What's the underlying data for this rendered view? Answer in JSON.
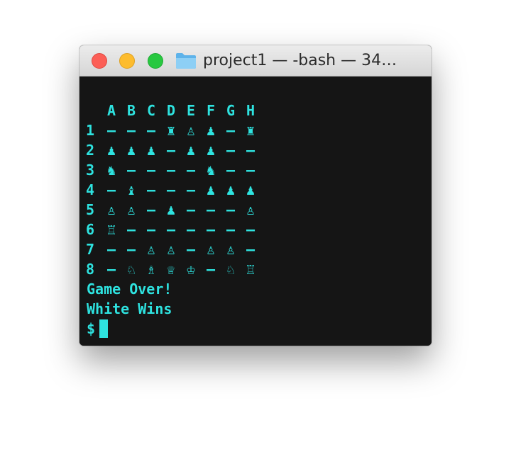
{
  "window": {
    "title": "project1 — -bash — 34…",
    "folder_icon": "folder-icon"
  },
  "board": {
    "columns": [
      "A",
      "B",
      "C",
      "D",
      "E",
      "F",
      "G",
      "H"
    ],
    "rows": [
      {
        "label": "1",
        "cells": [
          "–",
          "–",
          "–",
          "♜",
          "♙",
          "♟",
          "–",
          "♜"
        ]
      },
      {
        "label": "2",
        "cells": [
          "♟",
          "♟",
          "♟",
          "–",
          "♟",
          "♟",
          "–",
          "–"
        ]
      },
      {
        "label": "3",
        "cells": [
          "♞",
          "–",
          "–",
          "–",
          "–",
          "♞",
          "–",
          "–"
        ]
      },
      {
        "label": "4",
        "cells": [
          "–",
          "♝",
          "–",
          "–",
          "–",
          "♟",
          "♟",
          "♟"
        ]
      },
      {
        "label": "5",
        "cells": [
          "♙",
          "♙",
          "–",
          "♟",
          "–",
          "–",
          "–",
          "♙"
        ]
      },
      {
        "label": "6",
        "cells": [
          "♖",
          "–",
          "–",
          "–",
          "–",
          "–",
          "–",
          "–"
        ]
      },
      {
        "label": "7",
        "cells": [
          "–",
          "–",
          "♙",
          "♙",
          "–",
          "♙",
          "♙",
          "–"
        ]
      },
      {
        "label": "8",
        "cells": [
          "–",
          "♘",
          "♗",
          "♕",
          "♔",
          "–",
          "♘",
          "♖"
        ]
      }
    ]
  },
  "output": {
    "line1": "Game Over!",
    "line2": "White Wins"
  },
  "prompt": {
    "symbol": "$"
  },
  "colors": {
    "terminal_text": "#2ee3e0",
    "terminal_background": "#151515"
  }
}
